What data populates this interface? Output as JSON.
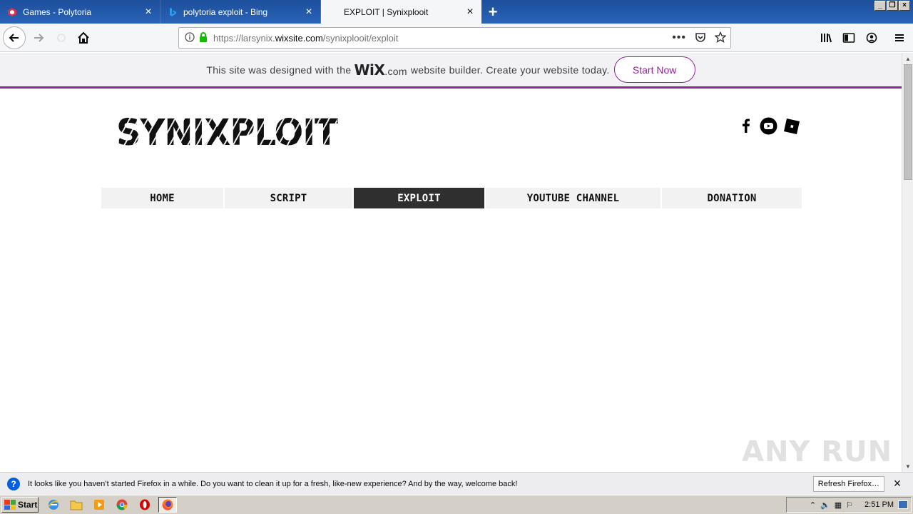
{
  "browser": {
    "tabs": [
      {
        "label": "Games - Polytoria",
        "icon": "polytoria-icon",
        "active": false
      },
      {
        "label": "polytoria exploit - Bing",
        "icon": "bing-icon",
        "active": false
      },
      {
        "label": "EXPLOIT | Synixplooit",
        "icon": "none",
        "active": true
      }
    ],
    "url_prefix": "https://larsynix.",
    "url_domain": "wixsite.com",
    "url_path": "/synixplooit/exploit",
    "window_controls": [
      "_",
      "❐",
      "×"
    ]
  },
  "wix_banner": {
    "text_before": "This site was designed with the",
    "logo_wix": "WiX",
    "logo_com": ".com",
    "text_after": "website builder. Create your website today.",
    "button_label": "Start Now",
    "accent_color": "#8c2497"
  },
  "site": {
    "logo_text": "SYNIXPLOIT",
    "social_icons": [
      "facebook-icon",
      "youtube-icon",
      "roblox-icon"
    ],
    "menu": [
      {
        "label": "HOME",
        "selected": false
      },
      {
        "label": "SCRIPT",
        "selected": false
      },
      {
        "label": "EXPLOIT",
        "selected": true
      },
      {
        "label": "YOUTUBE CHANNEL",
        "selected": false
      },
      {
        "label": "DONATION",
        "selected": false
      }
    ]
  },
  "watermark": "ANY RUN",
  "notification": {
    "text": "It looks like you haven’t started Firefox in a while. Do you want to clean it up for a fresh, like-new experience? And by the way, welcome back!",
    "button_label": "Refresh Firefox…",
    "close_label": "×"
  },
  "taskbar": {
    "start_label": "Start",
    "clock": "2:51 PM"
  }
}
